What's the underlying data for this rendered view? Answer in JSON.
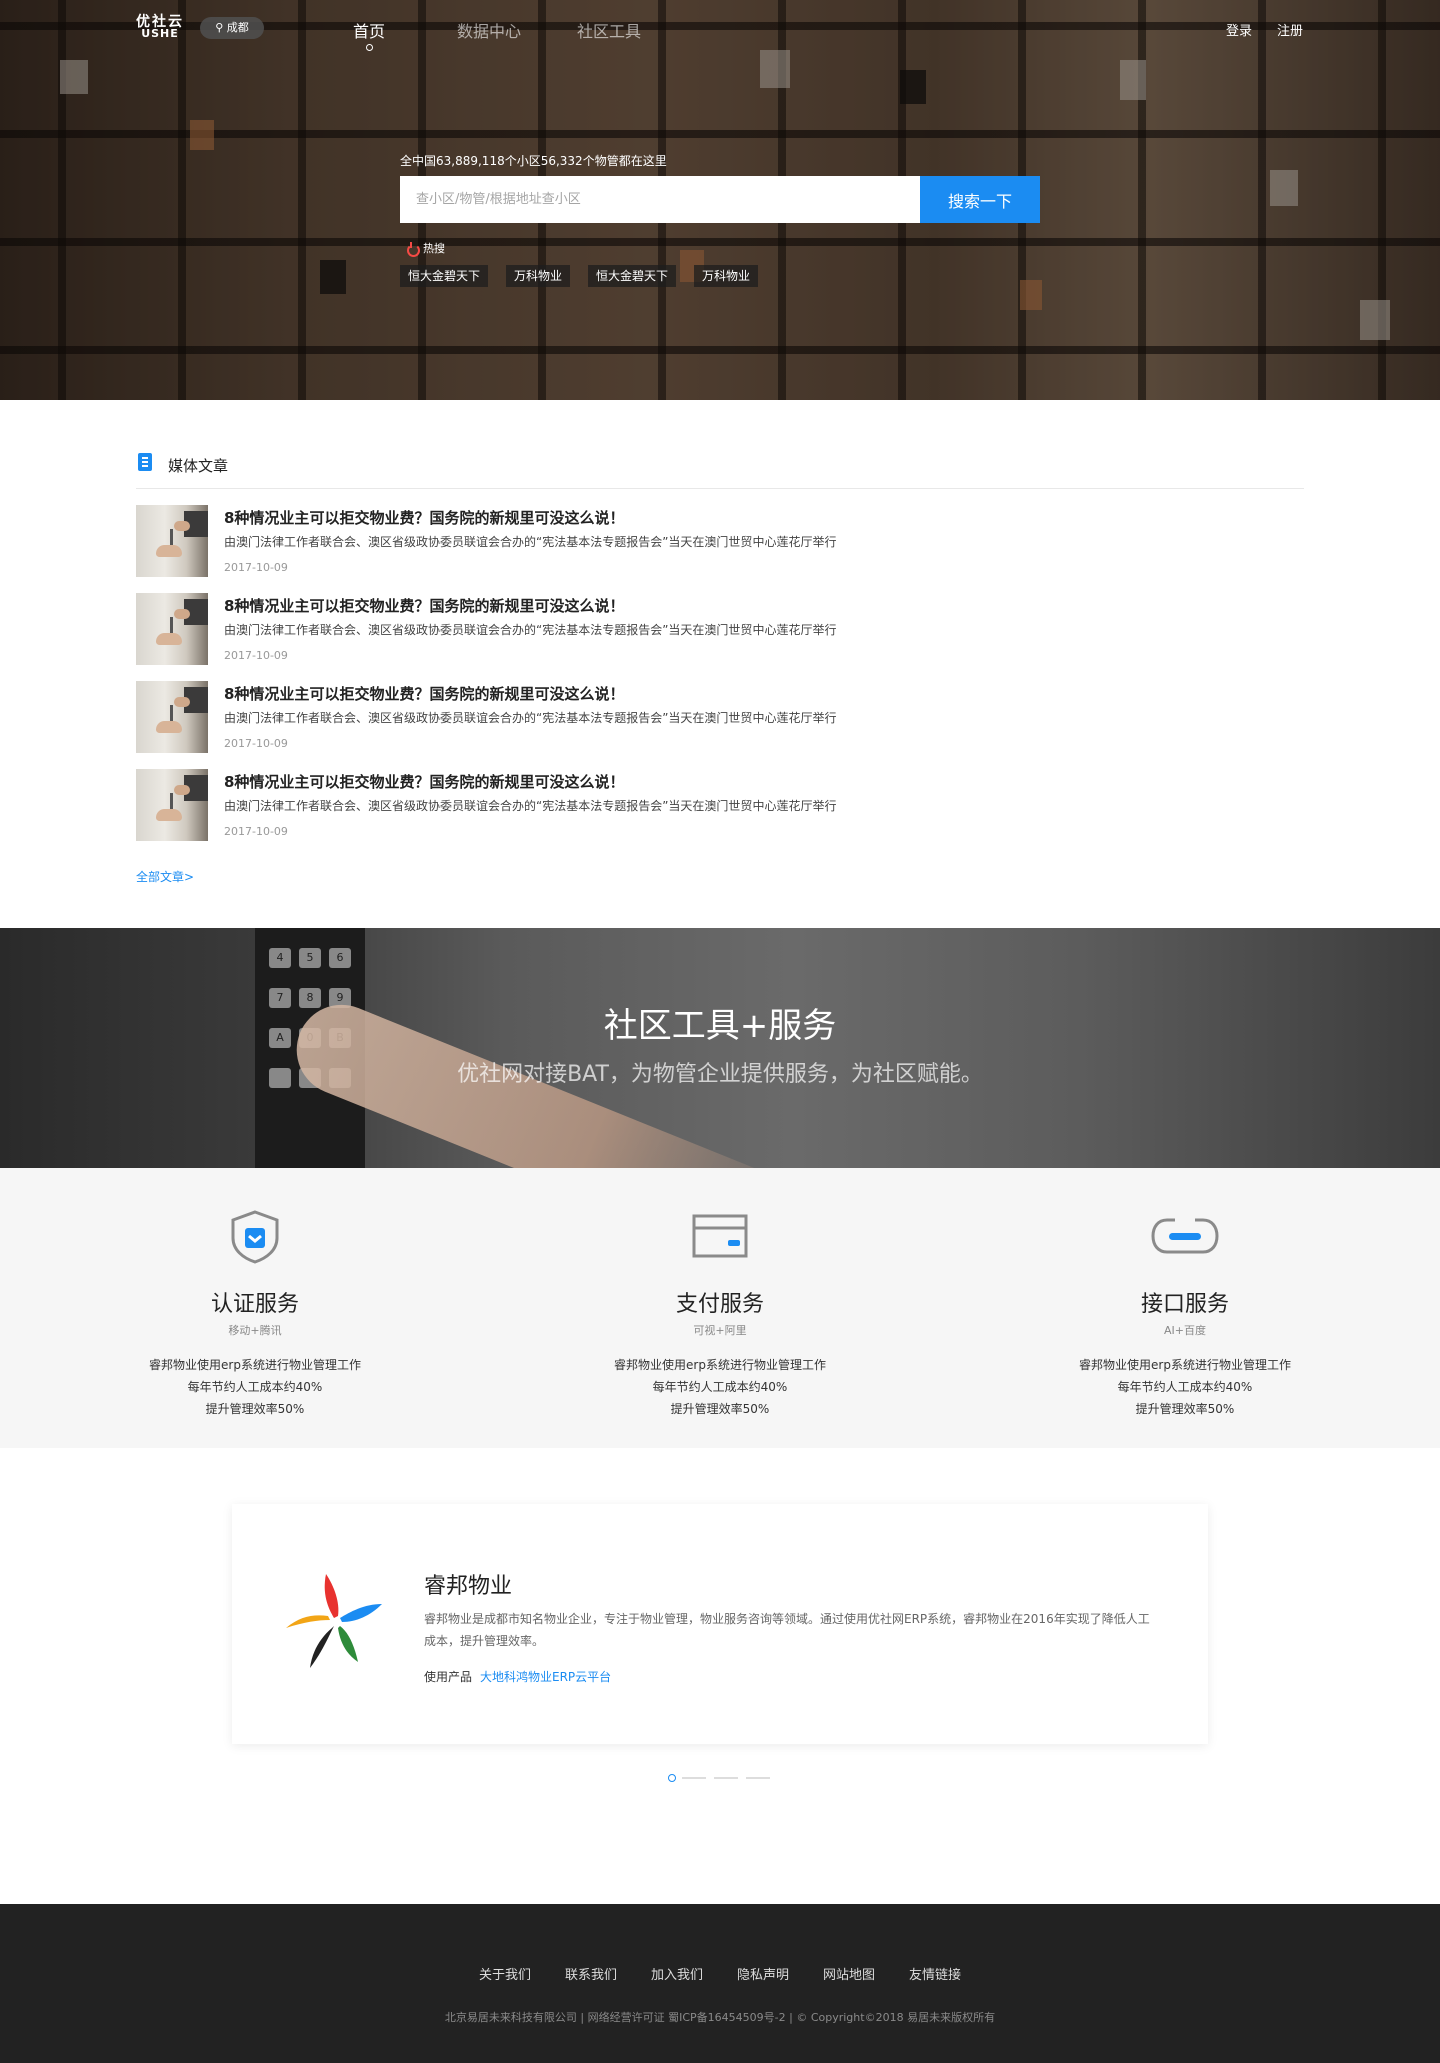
{
  "nav": {
    "logo_top": "优社云",
    "logo_bottom": "USHE",
    "city": "成都",
    "links": [
      {
        "label": "首页",
        "active": true
      },
      {
        "label": "数据中心",
        "active": false
      },
      {
        "label": "社区工具",
        "active": false
      }
    ],
    "login": "登录",
    "register": "注册"
  },
  "hero": {
    "count_text": "全中国63,889,118个小区56,332个物管都在这里",
    "search_placeholder": "查小区/物管/根据地址查小区",
    "search_button": "搜索一下",
    "hot_label": "热搜",
    "hot_tags": [
      "恒大金碧天下",
      "万科物业",
      "恒大金碧天下",
      "万科物业"
    ]
  },
  "articles": {
    "section_title": "媒体文章",
    "items": [
      {
        "title": "8种情况业主可以拒交物业费？国务院的新规里可没这么说！",
        "desc": "由澳门法律工作者联合会、澳区省级政协委员联谊会合办的“宪法基本法专题报告会”当天在澳门世贸中心莲花厅举行",
        "date": "2017-10-09"
      },
      {
        "title": "8种情况业主可以拒交物业费？国务院的新规里可没这么说！",
        "desc": "由澳门法律工作者联合会、澳区省级政协委员联谊会合办的“宪法基本法专题报告会”当天在澳门世贸中心莲花厅举行",
        "date": "2017-10-09"
      },
      {
        "title": "8种情况业主可以拒交物业费？国务院的新规里可没这么说！",
        "desc": "由澳门法律工作者联合会、澳区省级政协委员联谊会合办的“宪法基本法专题报告会”当天在澳门世贸中心莲花厅举行",
        "date": "2017-10-09"
      },
      {
        "title": "8种情况业主可以拒交物业费？国务院的新规里可没这么说！",
        "desc": "由澳门法律工作者联合会、澳区省级政协委员联谊会合办的“宪法基本法专题报告会”当天在澳门世贸中心莲花厅举行",
        "date": "2017-10-09"
      }
    ],
    "more_link": "全部文章>"
  },
  "banner": {
    "title": "社区工具+服务",
    "subtitle": "优社网对接BAT，为物管企业提供服务，为社区赋能。"
  },
  "services": [
    {
      "icon": "shield-check-icon",
      "name": "认证服务",
      "sub": "移动+腾讯",
      "lines": [
        "睿邦物业使用erp系统进行物业管理工作",
        "每年节约人工成本约40%",
        "提升管理效率50%"
      ]
    },
    {
      "icon": "card-icon",
      "name": "支付服务",
      "sub": "可视+阿里",
      "lines": [
        "睿邦物业使用erp系统进行物业管理工作",
        "每年节约人工成本约40%",
        "提升管理效率50%"
      ]
    },
    {
      "icon": "link-icon",
      "name": "接口服务",
      "sub": "AI+百度",
      "lines": [
        "睿邦物业使用erp系统进行物业管理工作",
        "每年节约人工成本约40%",
        "提升管理效率50%"
      ]
    }
  ],
  "case": {
    "name": "睿邦物业",
    "desc": "睿邦物业是成都市知名物业企业，专注于物业管理，物业服务咨询等领域。通过使用优社网ERP系统，睿邦物业在2016年实现了降低人工成本，提升管理效率。",
    "product_label": "使用产品",
    "product_link": "大地科鸿物业ERP云平台"
  },
  "footer": {
    "links": [
      "关于我们",
      "联系我们",
      "加入我们",
      "隐私声明",
      "网站地图",
      "友情链接"
    ],
    "copyright": "北京易居未来科技有限公司 | 网络经营许可证 蜀ICP备16454509号-2 | © Copyright©2018 易居未来版权所有"
  },
  "colors": {
    "accent": "#1b8cf2",
    "footer_bg": "#222222",
    "hot": "#f54a45"
  }
}
